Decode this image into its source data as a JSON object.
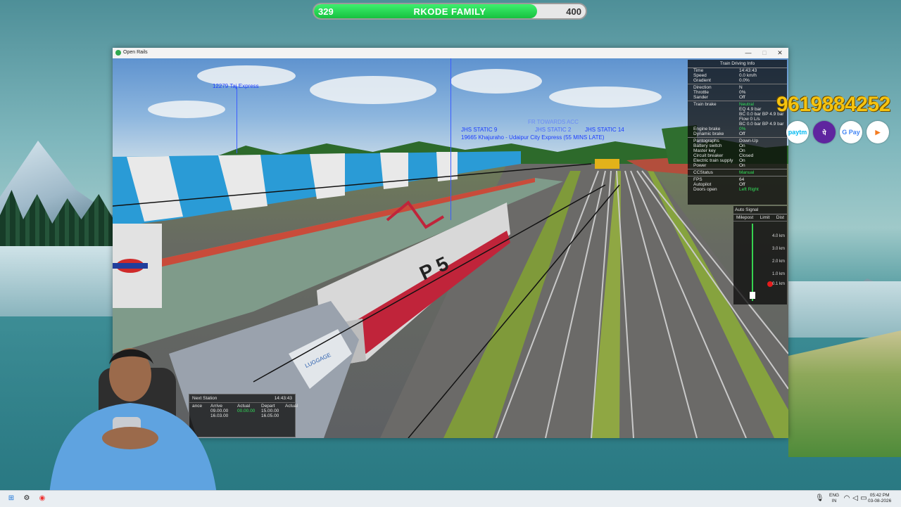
{
  "stream_goal": {
    "current": "329",
    "title": "RKODE FAMILY",
    "target": "400",
    "progress_fraction": 0.8225
  },
  "window": {
    "title": "Open Rails",
    "minimize": "—",
    "maximize": "□",
    "close": "✕"
  },
  "scene_labels": {
    "train_left": "12279 Taj Express",
    "towards": "FR TOWARDS ACC",
    "static9": "JHS STATIC 9",
    "static2": "JHS STATIC 2",
    "static14": "JHS STATIC 14",
    "train_right": "19665 Khajuraho - Udaipur City Express (55 MINS LATE)",
    "loco_number": "P 5",
    "coach_text": "LUGGAGE"
  },
  "train_driving_info": {
    "title": "Train Driving Info",
    "rows": [
      {
        "key": "Time",
        "value": "14:43:43"
      },
      {
        "key": "Speed",
        "value": "0.0 km/h"
      },
      {
        "key": "Gradient",
        "value": "0.0%"
      },
      {
        "sep": true
      },
      {
        "key": "Direction",
        "value": "N"
      },
      {
        "key": "Throttle",
        "value": "0%"
      },
      {
        "key": "Sander",
        "value": "Off"
      },
      {
        "sep": true
      },
      {
        "key": "Train brake",
        "value": "Neutral",
        "green": true
      },
      {
        "key": "",
        "value": "EQ 4.9 bar"
      },
      {
        "key": "",
        "value": "BC 0.0 bar BP 4.9 bar"
      },
      {
        "key": "",
        "value": "Flow 0 L/s"
      },
      {
        "key": "",
        "value": "BC 0.0 bar BP 4.9 bar"
      },
      {
        "key": "Engine brake",
        "value": "0%",
        "green": true
      },
      {
        "key": "Dynamic brake",
        "value": "Off"
      },
      {
        "sep": true
      },
      {
        "key": "Pantographs",
        "value": "Down-Up"
      },
      {
        "key": "Battery switch",
        "value": "On"
      },
      {
        "key": "Master key",
        "value": "On"
      },
      {
        "key": "Circuit breaker",
        "value": "Closed"
      },
      {
        "key": "Electric train supply",
        "value": "On"
      },
      {
        "key": "Power",
        "value": "On"
      },
      {
        "sep": true
      },
      {
        "key": "CCStatus",
        "value": "Manual",
        "green": true
      },
      {
        "sep": true
      },
      {
        "key": "FPS",
        "value": "64"
      },
      {
        "key": "Autopilot",
        "value": "Off"
      },
      {
        "key": "Doors open",
        "value": "Left Right",
        "green": true
      }
    ]
  },
  "auto_signal": {
    "title": "Auto Signal",
    "columns": [
      "Milepost",
      "Limit",
      "Dist"
    ],
    "distances": [
      "4.0 km",
      "3.0 km",
      "2.0 km",
      "1.0 km",
      "0.1 km"
    ]
  },
  "next_station": {
    "title": "Next Station",
    "time": "14:43:43",
    "headers": [
      "ance",
      "Arrive",
      "Actual",
      "Depart",
      "Actual"
    ],
    "rows": [
      [
        "",
        "09.00.00",
        "00.00.00",
        "15.00.00",
        ""
      ],
      [
        "",
        "16.03.00",
        "",
        "16.05.00",
        ""
      ]
    ]
  },
  "sponsor": {
    "phone": "9619884252",
    "payments": [
      {
        "label": "paytm",
        "icon": "paytm-icon",
        "bg": "#ffffff",
        "fg": "#00b9f1"
      },
      {
        "label": "पे",
        "icon": "phonepe-icon",
        "bg": "#5f259f",
        "fg": "#ffffff"
      },
      {
        "label": "G Pay",
        "icon": "gpay-icon",
        "bg": "#ffffff",
        "fg": "#4285f4"
      },
      {
        "label": "▶",
        "icon": "bhim-icon",
        "bg": "#ffffff",
        "fg": "#f47b20"
      }
    ]
  },
  "taskbar": {
    "lang_top": "ENG",
    "lang_bottom": "IN",
    "time": "05:42 PM",
    "date": "03-08-2026"
  }
}
